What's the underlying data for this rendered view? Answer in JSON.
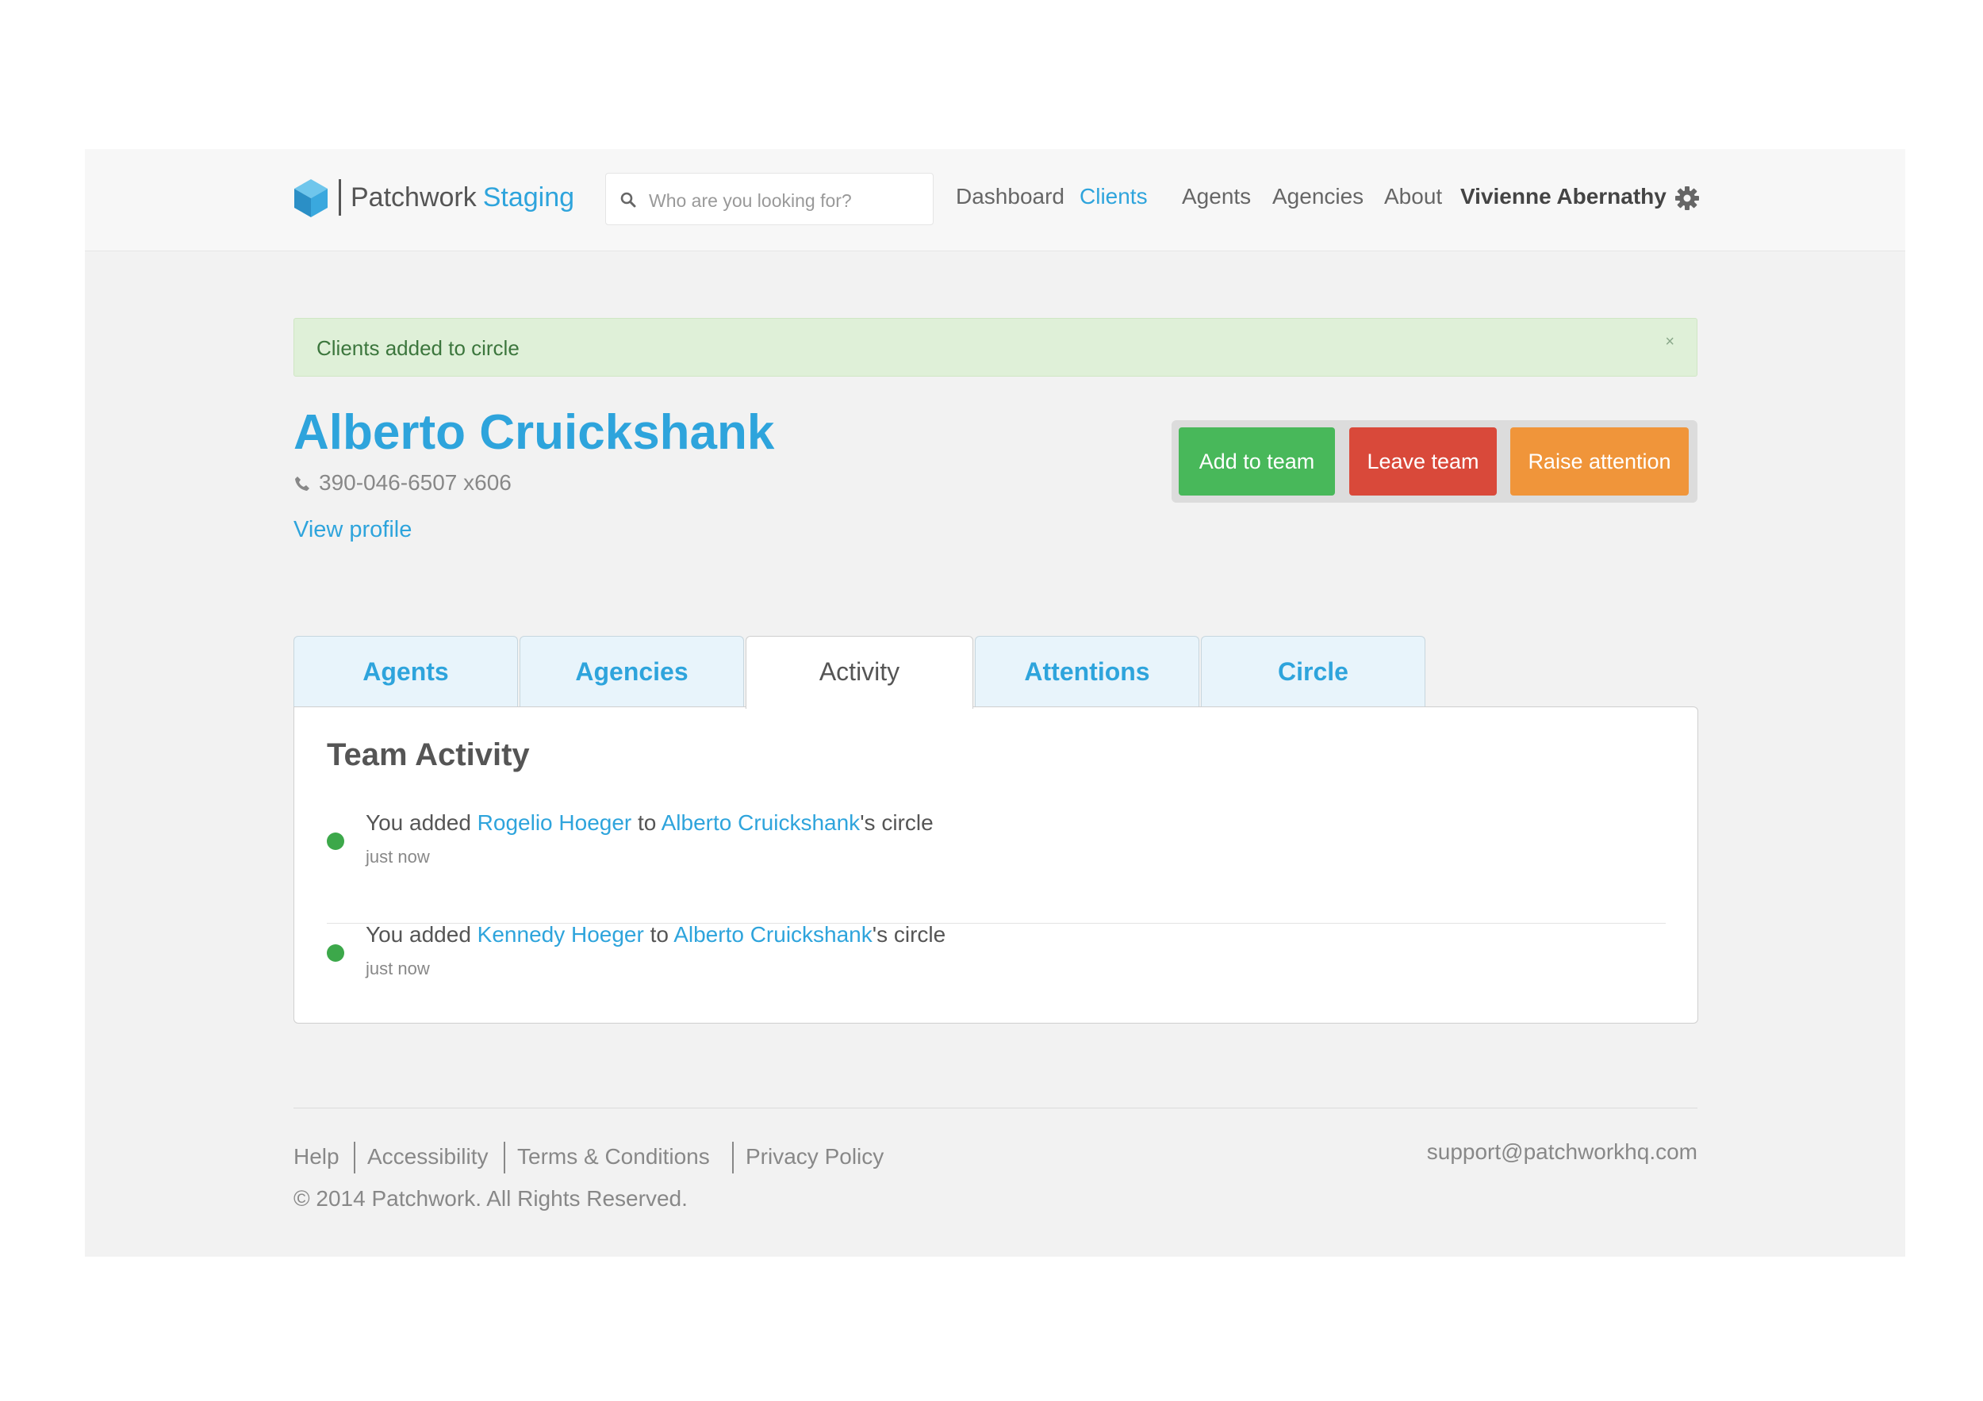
{
  "header": {
    "brand": "Patchwork",
    "environment": "Staging",
    "search_placeholder": "Who are you looking for?",
    "nav": {
      "dashboard": "Dashboard",
      "clients": "Clients",
      "agents": "Agents",
      "agencies": "Agencies",
      "about": "About"
    },
    "active_nav": "Clients",
    "user_name": "Vivienne Abernathy"
  },
  "alert": {
    "message": "Clients added to circle",
    "close": "×"
  },
  "client": {
    "name": "Alberto Cruickshank",
    "phone": "390-046-6507 x606",
    "view_profile": "View profile"
  },
  "actions": {
    "add_to_team": "Add to team",
    "leave_team": "Leave team",
    "raise_attention": "Raise attention"
  },
  "tabs": {
    "agents": "Agents",
    "agencies": "Agencies",
    "activity": "Activity",
    "attentions": "Attentions",
    "circle": "Circle",
    "active": "Activity"
  },
  "activity_panel": {
    "title": "Team Activity",
    "items": [
      {
        "prefix": "You added ",
        "agent": "Rogelio Hoeger",
        "middle": " to ",
        "client": "Alberto Cruickshank",
        "suffix": "'s circle",
        "time": "just now"
      },
      {
        "prefix": "You added ",
        "agent": "Kennedy Hoeger",
        "middle": " to ",
        "client": "Alberto Cruickshank",
        "suffix": "'s circle",
        "time": "just now"
      }
    ]
  },
  "footer": {
    "help": "Help",
    "accessibility": "Accessibility",
    "terms": "Terms & Conditions",
    "privacy": "Privacy Policy",
    "copyright": "© 2014 Patchwork. All Rights Reserved.",
    "support_email": "support@patchworkhq.com"
  },
  "colors": {
    "accent": "#2ea4dc",
    "success": "#48b85a",
    "danger": "#d9493a",
    "warning": "#f0953a",
    "alert_bg": "#dff0d8",
    "status_dot": "#3ca84a"
  },
  "icons": {
    "logo": "cube-logo-icon",
    "search": "search-icon",
    "settings": "gear-icon",
    "phone": "phone-icon",
    "close": "close-icon",
    "activity": "status-dot-icon"
  }
}
